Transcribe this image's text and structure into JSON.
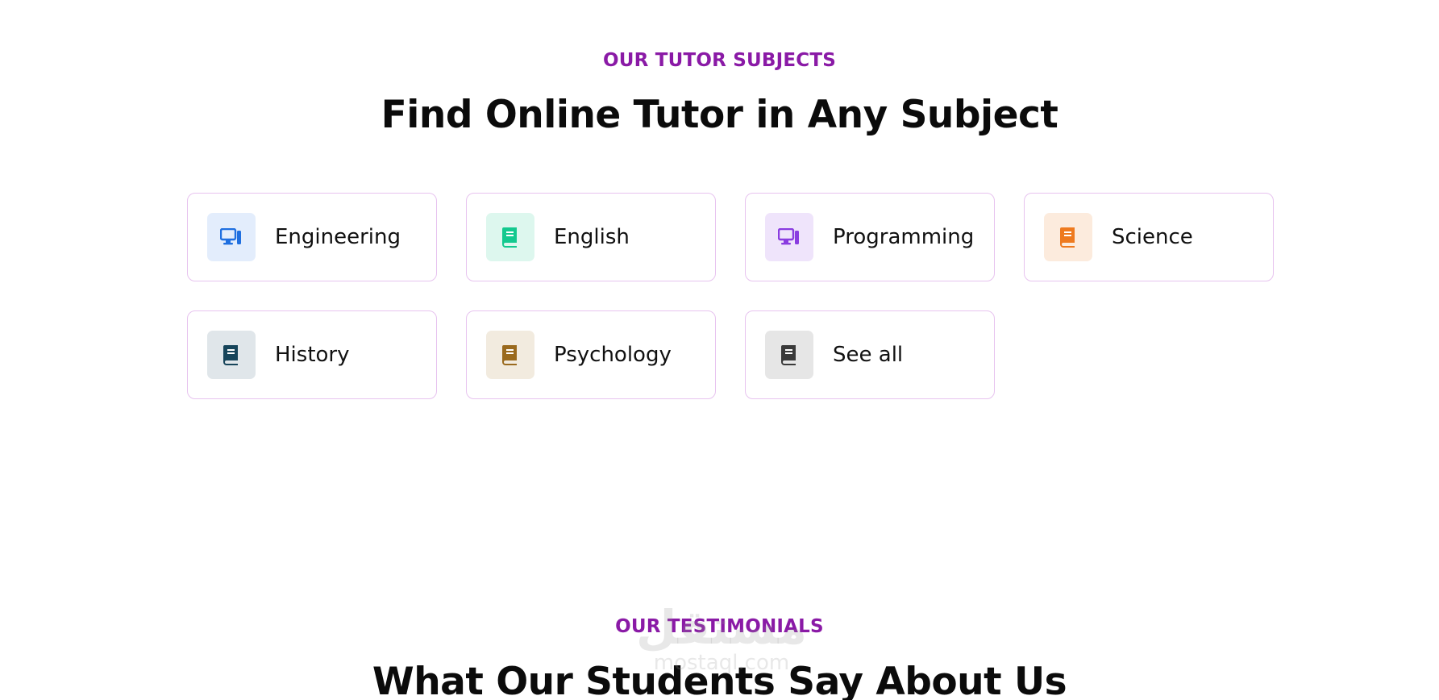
{
  "subjects_section": {
    "eyebrow": "OUR TUTOR SUBJECTS",
    "title": "Find Online Tutor in Any Subject",
    "cards": [
      {
        "label": "Engineering",
        "icon": "computer-icon",
        "icon_color": "#1f6fe0",
        "bg_color": "#e3edfc"
      },
      {
        "label": "English",
        "icon": "book-icon",
        "icon_color": "#14c98f",
        "bg_color": "#ddf7ee"
      },
      {
        "label": "Programming",
        "icon": "computer-icon",
        "icon_color": "#8a3ce0",
        "bg_color": "#efe4fb"
      },
      {
        "label": "Science",
        "icon": "book-icon",
        "icon_color": "#ee7a1f",
        "bg_color": "#fcebdd"
      },
      {
        "label": "History",
        "icon": "book-icon",
        "icon_color": "#16445a",
        "bg_color": "#e0e6ea"
      },
      {
        "label": "Psychology",
        "icon": "book-icon",
        "icon_color": "#9a6a1e",
        "bg_color": "#f2ebdf"
      },
      {
        "label": "See all",
        "icon": "book-icon",
        "icon_color": "#3a3a3a",
        "bg_color": "#e6e6e6"
      }
    ]
  },
  "testimonials_section": {
    "eyebrow": "OUR TESTIMONIALS",
    "title": "What Our Students Say About Us"
  },
  "watermark": {
    "arabic": "مستقل",
    "latin": "mostaql.com"
  },
  "colors": {
    "accent": "#8a1aa6",
    "card_border": "#e7c3ef"
  }
}
